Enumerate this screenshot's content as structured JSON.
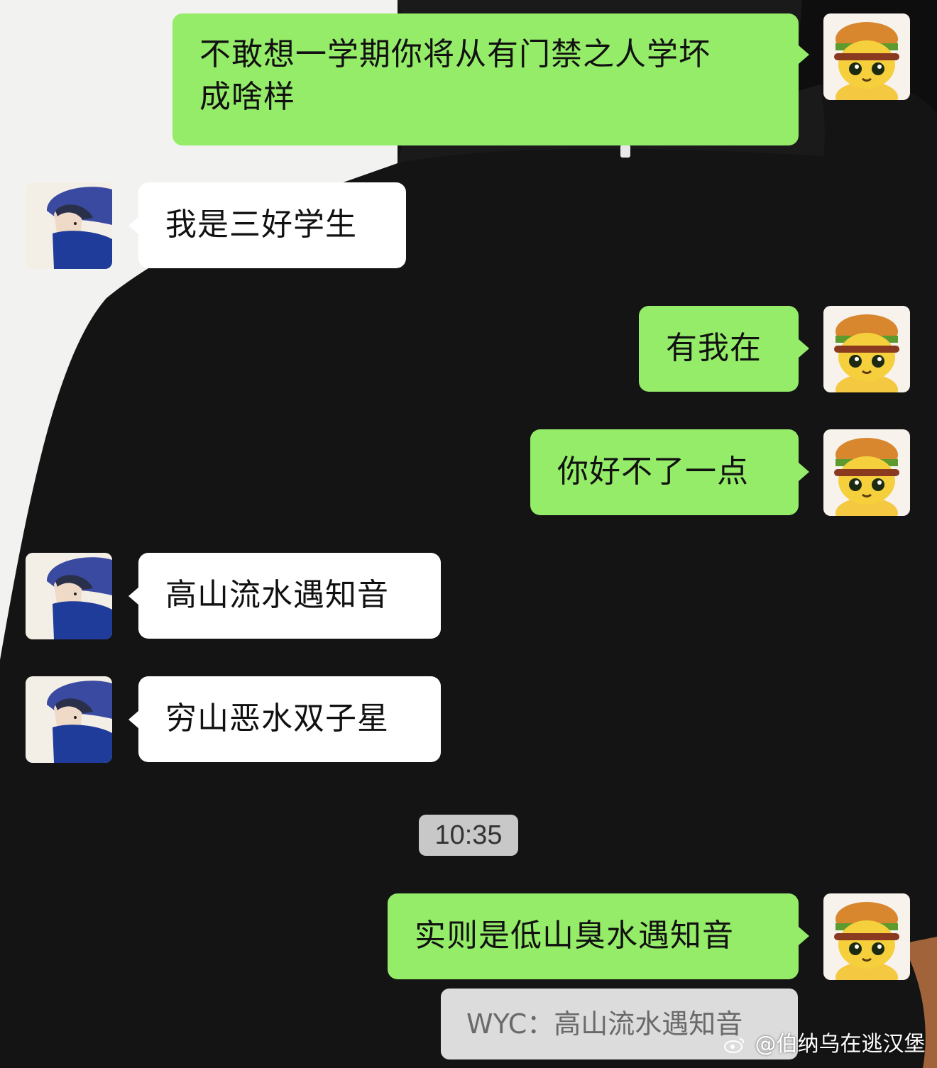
{
  "colors": {
    "my_bubble": "#95ec69",
    "other_bubble": "#ffffff",
    "time_badge": "#c8c8c8",
    "quote_bg": "#dcdcdc"
  },
  "messages": [
    {
      "sender": "me",
      "text": "不敢想一学期你将从有门禁之人学坏\n成啥样",
      "avatar": "burger-character-avatar"
    },
    {
      "sender": "other",
      "text": "我是三好学生",
      "avatar": "snow-boy-avatar"
    },
    {
      "sender": "me",
      "text": "有我在",
      "avatar": "burger-character-avatar"
    },
    {
      "sender": "me",
      "text": "你好不了一点",
      "avatar": "burger-character-avatar"
    },
    {
      "sender": "other",
      "text": "高山流水遇知音",
      "avatar": "snow-boy-avatar"
    },
    {
      "sender": "other",
      "text": "穷山恶水双子星",
      "avatar": "snow-boy-avatar"
    },
    {
      "sender": "me",
      "text": "实则是低山臭水遇知音",
      "avatar": "burger-character-avatar"
    }
  ],
  "timestamp": "10:35",
  "quote": {
    "text": "WYC：高山流水遇知音"
  },
  "watermark": {
    "text": "@伯纳乌在逃汉堡"
  }
}
